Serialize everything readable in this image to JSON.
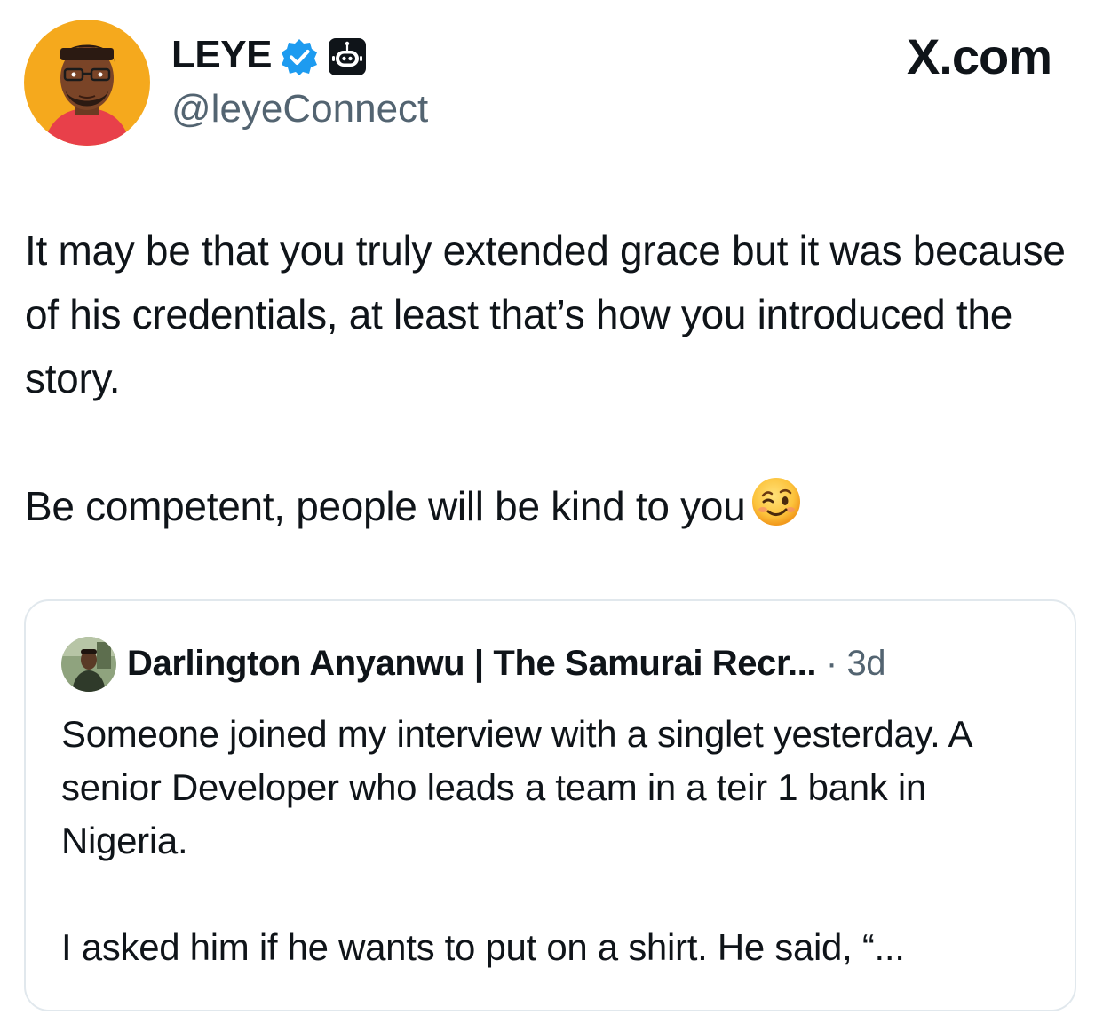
{
  "author": {
    "display_name": "LEYE",
    "handle": "@leyeConnect",
    "avatar_icon": "cartoon-avatar-icon",
    "verified_icon": "verified-badge-icon",
    "automated_icon": "robot-badge-icon"
  },
  "brand": {
    "label": "X.com"
  },
  "tweet": {
    "paragraph_1": "It may be that you truly extended grace but it was because of his credentials, at least that’s how you introduced the story.",
    "paragraph_2": "Be competent, people will be kind to you",
    "emoji_icon": "winking-face-emoji-icon"
  },
  "quoted_tweet": {
    "display_name": "Darlington Anyanwu | The Samurai Recr...",
    "separator": "·",
    "time": "3d",
    "paragraph_1": "Someone joined my interview with a singlet yesterday. A senior Developer who leads a team in a teir 1 bank in Nigeria.",
    "paragraph_2": "I asked him if he wants to put on a shirt. He said, “..."
  },
  "colors": {
    "text_primary": "#0f1419",
    "text_secondary": "#536471",
    "verified_blue": "#1d9bf0",
    "card_border": "#e1e8ed",
    "avatar_bg": "#f5a91d"
  }
}
